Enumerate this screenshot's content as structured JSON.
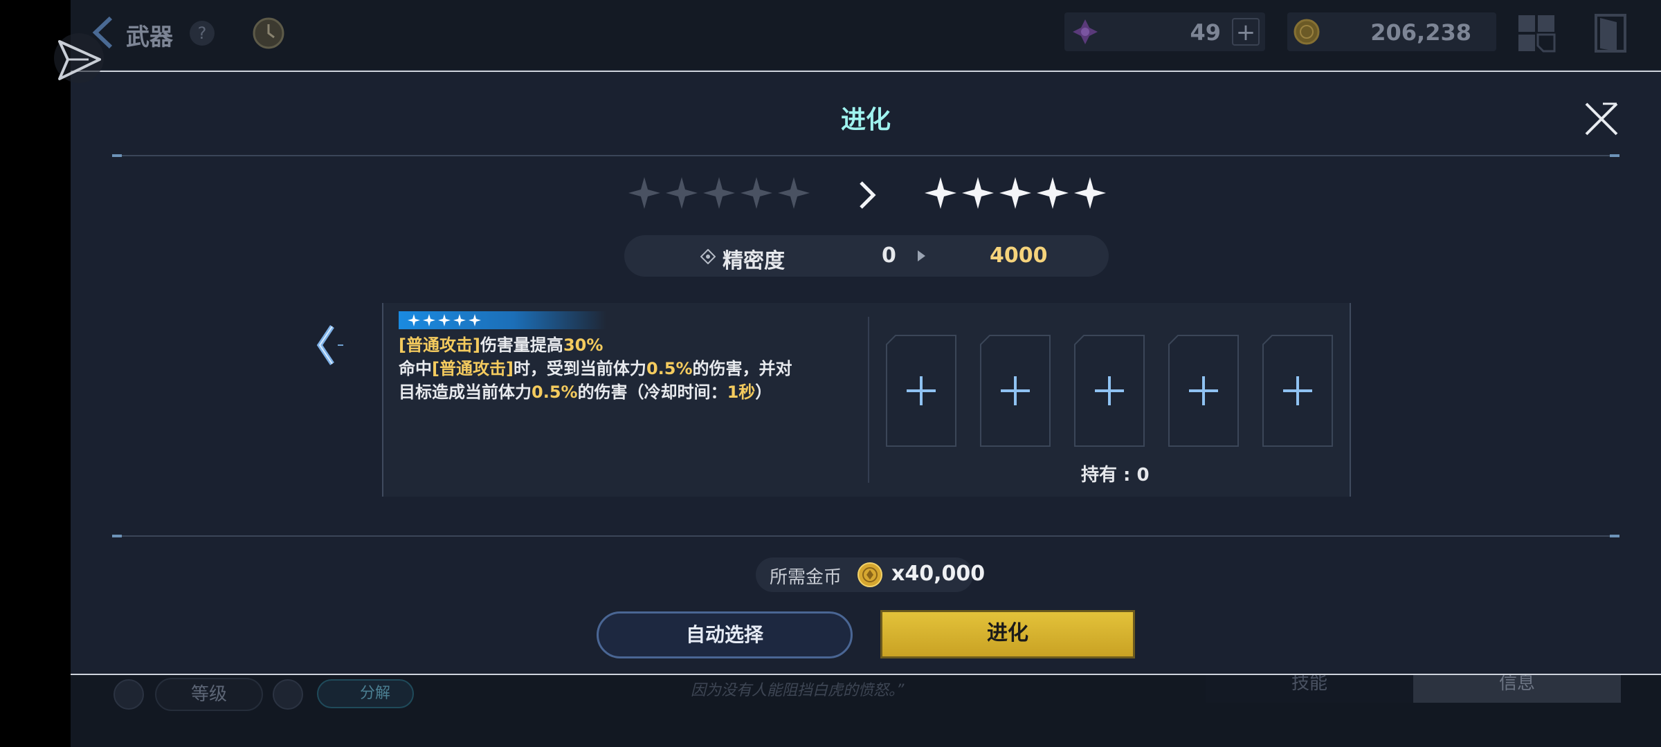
{
  "topbar": {
    "title": "武器",
    "help": "?",
    "resource1": {
      "value": "49",
      "plus": "+",
      "icon": "purple-crystal-icon"
    },
    "resource2": {
      "value": "206,238",
      "icon": "gold-coin-icon"
    }
  },
  "modal": {
    "title": "进化",
    "stars_before": 5,
    "stars_after": 5,
    "precision": {
      "label": "精密度",
      "from": "0",
      "to": "4000"
    },
    "tag_stars": 5,
    "description": {
      "line1_a": "[普通攻击]",
      "line1_b": "伤害量提高",
      "line1_c": "30%",
      "line2_a": "命中",
      "line2_b": "[普通攻击]",
      "line2_c": "时，受到当前体力",
      "line2_d": "0.5%",
      "line2_e": "的伤害，并对",
      "line3_a": "目标造成当前体力",
      "line3_b": "0.5%",
      "line3_c": "的伤害（冷却时间：",
      "line3_d": "1秒",
      "line3_e": "）"
    },
    "slots": [
      "+",
      "+",
      "+",
      "+",
      "+"
    ],
    "owned": "持有 : 0",
    "cost_label": "所需金币",
    "cost_amount": "x40,000",
    "auto_select": "自动选择",
    "evolve_button": "进化"
  },
  "bottombar": {
    "level": "等级",
    "decompose": "分解",
    "quote": "因为没有人能阻挡白虎的愤怒。”",
    "tab_skill": "技能",
    "tab_info": "信息"
  },
  "colors": {
    "accent_title": "#9ff3ef",
    "highlight": "#f4cb5e",
    "button_gold": "#d4b12e"
  }
}
